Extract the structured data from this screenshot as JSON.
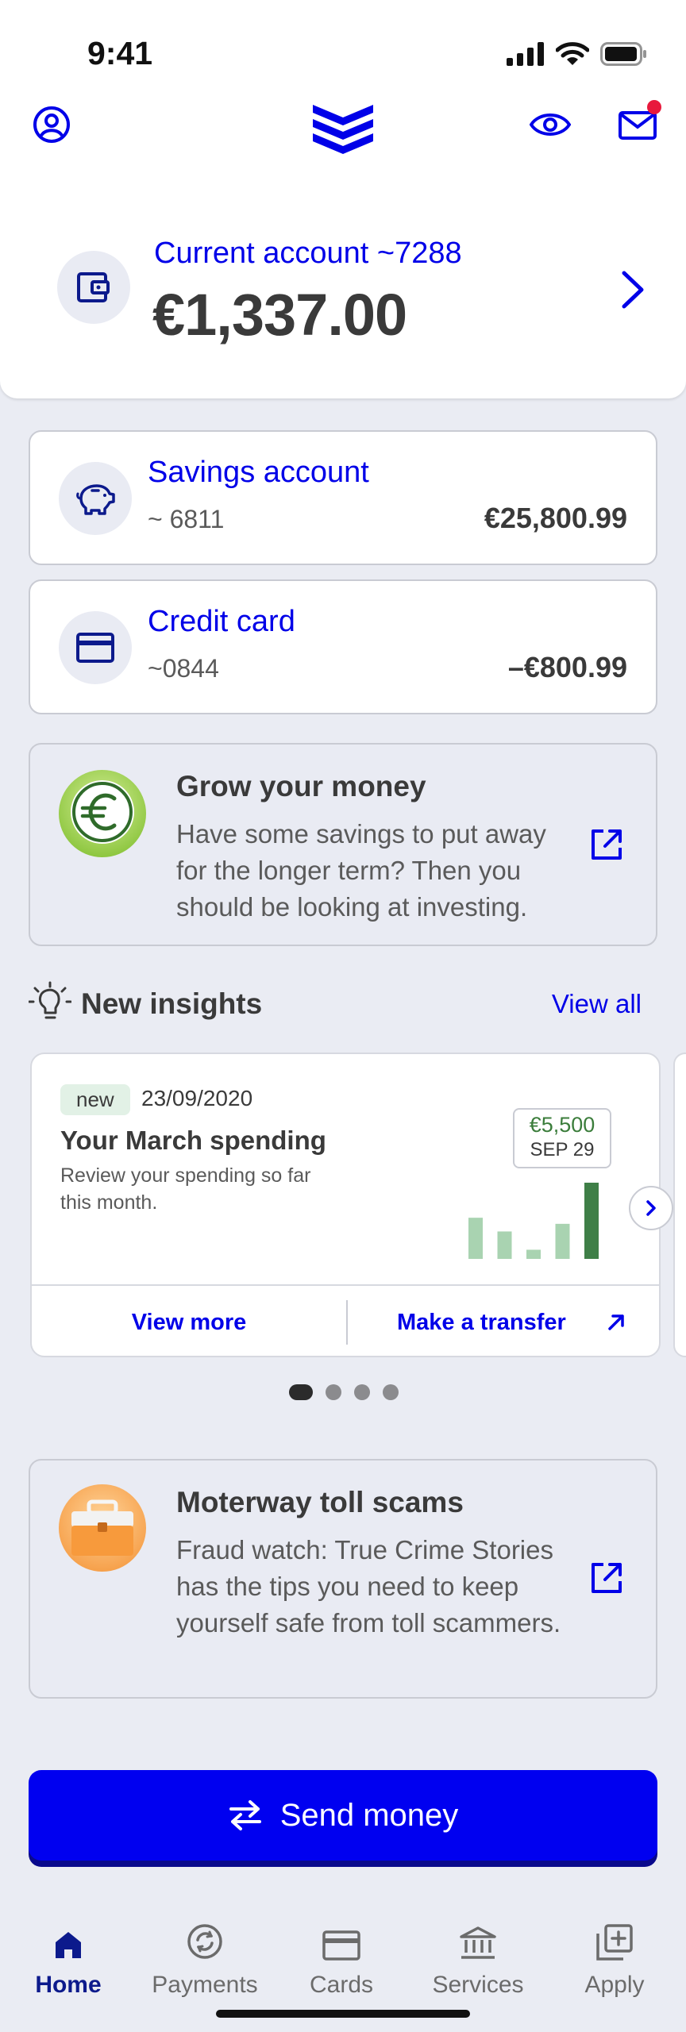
{
  "status_bar": {
    "time": "9:41"
  },
  "current_account": {
    "name": "Current account ~7288",
    "balance": "€1,337.00"
  },
  "accounts": [
    {
      "name": "Savings account",
      "number": "~ 6811",
      "amount": "€25,800.99"
    },
    {
      "name": "Credit card",
      "number": "~0844",
      "amount": "–€800.99"
    }
  ],
  "promo_grow": {
    "title": "Grow your money",
    "body": "Have some savings to put away for the longer term? Then you should be looking at investing."
  },
  "insights": {
    "title": "New insights",
    "view_all": "View all",
    "card": {
      "badge": "new",
      "date": "23/09/2020",
      "title": "Your March spending",
      "description": "Review your spending so far this month.",
      "tooltip_value": "€5,500",
      "tooltip_date": "SEP 29",
      "bars": [
        0.54,
        0.36,
        0.12,
        0.46,
        1.0
      ],
      "view_more": "View more",
      "make_transfer": "Make a transfer"
    },
    "page_count": 4,
    "active_page": 1
  },
  "promo_toll": {
    "title": "Moterway toll scams",
    "body": "Fraud watch: True Crime Stories has the tips you need to keep yourself safe from toll scammers."
  },
  "send_money": "Send money",
  "tabs": [
    {
      "label": "Home",
      "icon": "home-icon",
      "active": true
    },
    {
      "label": "Payments",
      "icon": "payments-icon",
      "active": false
    },
    {
      "label": "Cards",
      "icon": "card-icon",
      "active": false
    },
    {
      "label": "Services",
      "icon": "bank-icon",
      "active": false
    },
    {
      "label": "Apply",
      "icon": "add-box-icon",
      "active": false
    }
  ],
  "colors": {
    "accent": "#0000e8",
    "button": "#0000f0",
    "background": "#eaecf3",
    "chart_highlight": "#3f7f47",
    "chart_bar": "#a9d3b1"
  }
}
